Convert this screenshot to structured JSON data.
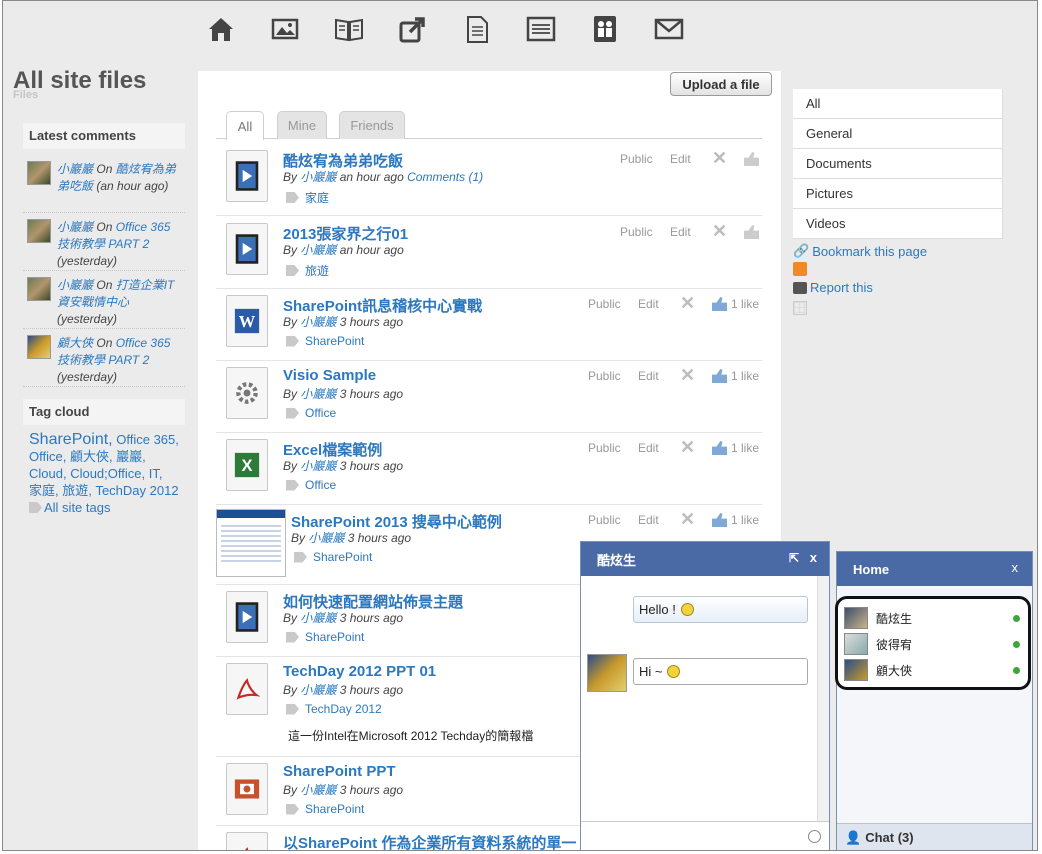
{
  "toolbar": {
    "icons": [
      "home-icon",
      "image-icon",
      "book-icon",
      "share-icon",
      "document-icon",
      "list-icon",
      "people-icon",
      "mail-icon"
    ]
  },
  "page": {
    "title": "All site files",
    "subtitle": "Files"
  },
  "latest_comments": {
    "header": "Latest comments",
    "items": [
      {
        "user": "小巖巖",
        "on": "On",
        "target": "酷炫宥為弟弟吃飯",
        "time": "(an hour ago)"
      },
      {
        "user": "小巖巖",
        "on": "On",
        "target": "Office 365 技術教學 PART 2",
        "time": "(yesterday)"
      },
      {
        "user": "小巖巖",
        "on": "On",
        "target": "打造企業IT資安戰情中心",
        "time": "(yesterday)"
      },
      {
        "user": "顧大俠",
        "on": "On",
        "target": "Office 365 技術教學 PART 2",
        "time": "(yesterday)"
      }
    ]
  },
  "tag_cloud": {
    "header": "Tag cloud",
    "big": "SharePoint,",
    "rest": "Office 365, Office, 顧大俠, 巖巖, Cloud, Cloud;Office, IT, 家庭, 旅遊, TechDay 2012",
    "all_link": "All site tags"
  },
  "center": {
    "upload_label": "Upload a file",
    "tabs": [
      "All",
      "Mine",
      "Friends"
    ],
    "files": [
      {
        "title": "酷炫宥為弟弟吃飯",
        "by": "By",
        "user": "小巖巖",
        "time": "an hour ago",
        "comments": "Comments (1)",
        "tag": "家庭",
        "public": "Public",
        "edit": "Edit",
        "like": "",
        "type": "video"
      },
      {
        "title": "2013張家界之行01",
        "by": "By",
        "user": "小巖巖",
        "time": "an hour ago",
        "comments": "",
        "tag": "旅遊",
        "public": "Public",
        "edit": "Edit",
        "like": "",
        "type": "video"
      },
      {
        "title": "SharePoint訊息稽核中心實戰",
        "by": "By",
        "user": "小巖巖",
        "time": "3 hours ago",
        "comments": "",
        "tag": "SharePoint",
        "public": "Public",
        "edit": "Edit",
        "like": "1 like",
        "type": "word"
      },
      {
        "title": "Visio Sample",
        "by": "By",
        "user": "小巖巖",
        "time": "3 hours ago",
        "comments": "",
        "tag": "Office",
        "public": "Public",
        "edit": "Edit",
        "like": "1 like",
        "type": "gear"
      },
      {
        "title": "Excel檔案範例",
        "by": "By",
        "user": "小巖巖",
        "time": "3 hours ago",
        "comments": "",
        "tag": "Office",
        "public": "Public",
        "edit": "Edit",
        "like": "1 like",
        "type": "excel"
      },
      {
        "title": "SharePoint 2013 搜尋中心範例",
        "by": "By",
        "user": "小巖巖",
        "time": "3 hours ago",
        "comments": "",
        "tag": "SharePoint",
        "public": "Public",
        "edit": "Edit",
        "like": "1 like",
        "type": "screenshot"
      },
      {
        "title": "如何快速配置網站佈景主題",
        "by": "By",
        "user": "小巖巖",
        "time": "3 hours ago",
        "comments": "",
        "tag": "SharePoint",
        "public": "",
        "edit": "",
        "like": "",
        "type": "video"
      },
      {
        "title": "TechDay 2012 PPT 01",
        "by": "By",
        "user": "小巖巖",
        "time": "3 hours ago",
        "comments": "",
        "tag": "TechDay 2012",
        "public": "",
        "edit": "",
        "like": "",
        "type": "pdf",
        "desc": "這一份Intel在Microsoft 2012 Techday的簡報檔"
      },
      {
        "title": "SharePoint PPT",
        "by": "By",
        "user": "小巖巖",
        "time": "3 hours ago",
        "comments": "",
        "tag": "SharePoint",
        "public": "",
        "edit": "",
        "like": "",
        "type": "ppt"
      },
      {
        "title": "以SharePoint 作為企業所有資料系統的單一",
        "by": "",
        "user": "",
        "time": "",
        "comments": "",
        "tag": "",
        "public": "",
        "edit": "",
        "like": "",
        "type": "pdf"
      }
    ]
  },
  "right_nav": {
    "items": [
      "All",
      "General",
      "Documents",
      "Pictures",
      "Videos"
    ],
    "bookmark": "Bookmark this page",
    "report": "Report this"
  },
  "chat": {
    "title": "酷炫生",
    "messages": [
      {
        "text": "Hello !",
        "side": "right"
      },
      {
        "text": "Hi ~",
        "side": "left"
      }
    ]
  },
  "home": {
    "title": "Home",
    "close": "x",
    "contacts": [
      "酷炫生",
      "彼得宥",
      "顧大俠"
    ],
    "footer": "Chat (3)"
  }
}
